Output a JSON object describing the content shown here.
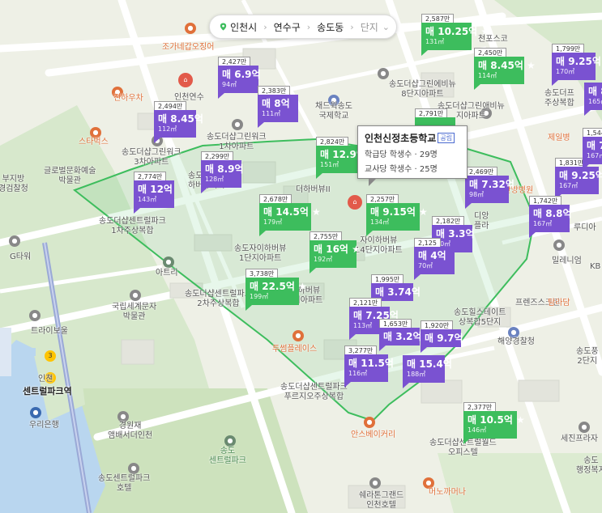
{
  "breadcrumb": {
    "city": "인천시",
    "district": "연수구",
    "dong": "송도동",
    "complex": "단지"
  },
  "school_tooltip": {
    "name": "인천신정초등학교",
    "badge": "공립",
    "hakgudang": "학급당 학생수 · 29명",
    "gyosadang": "교사당 학생수 · 25명"
  },
  "listings": [
    {
      "id": "m1",
      "price_top": "2,587만",
      "label": "매 10.25억 ★",
      "area": "131㎡",
      "color": "green"
    },
    {
      "id": "m2",
      "price_top": "2,450만",
      "label": "매 8.45억 ★",
      "area": "114㎡",
      "color": "green"
    },
    {
      "id": "m3",
      "price_top": "1,799만",
      "label": "매 9.25억",
      "area": "170㎡",
      "color": "purple"
    },
    {
      "id": "m4",
      "price_top": "2,427만",
      "label": "매 6.9억",
      "area": "94㎡",
      "color": "purple"
    },
    {
      "id": "m5",
      "price_top": "2,383만",
      "label": "매 8억",
      "area": "111㎡",
      "color": "purple"
    },
    {
      "id": "m6",
      "price_top": "2,494만",
      "label": "매 8.45억",
      "area": "112㎡",
      "color": "purple"
    },
    {
      "id": "m7",
      "price_top": "2,791만",
      "label": "",
      "area": "",
      "color": "green"
    },
    {
      "id": "m8",
      "price_top": "2,824만",
      "label": "매 12.9억",
      "area": "151㎡",
      "color": "green"
    },
    {
      "id": "m9",
      "price_top": "2,299만",
      "label": "매 8.9억",
      "area": "128㎡",
      "color": "purple"
    },
    {
      "id": "m10",
      "price_top": "2,774만",
      "label": "매 12억",
      "area": "143㎡",
      "color": "purple"
    },
    {
      "id": "m11",
      "price_top": "2,469만",
      "label": "매 7.32억",
      "area": "98㎡",
      "color": "purple"
    },
    {
      "id": "m12",
      "price_top": "1,831만",
      "label": "매 9.25억",
      "area": "167㎡",
      "color": "purple"
    },
    {
      "id": "m13",
      "price_top": "1,742만",
      "label": "매 8.8억",
      "area": "167㎡",
      "color": "purple"
    },
    {
      "id": "m14",
      "price_top": "2,678만",
      "label": "매 14.5억 ★",
      "area": "179㎡",
      "color": "green"
    },
    {
      "id": "m15",
      "price_top": "2,257만",
      "label": "매 9.15억 ★",
      "area": "134㎡",
      "color": "green"
    },
    {
      "id": "m16",
      "price_top": "2,182만",
      "label": "매 3.3억",
      "area": "50㎡",
      "color": "purple"
    },
    {
      "id": "m17",
      "price_top": "2,755만",
      "label": "매 16억 ★",
      "area": "192㎡",
      "color": "green"
    },
    {
      "id": "m18",
      "price_top": "2,125",
      "label": "매 4억",
      "area": "70㎡",
      "color": "purple"
    },
    {
      "id": "m19",
      "price_top": "3,738만",
      "label": "매 22.5억 ★",
      "area": "199㎡",
      "color": "green"
    },
    {
      "id": "m20",
      "price_top": "1,995만",
      "label": "매 3.74억",
      "area": "",
      "color": "purple"
    },
    {
      "id": "m21",
      "price_top": "2,121만",
      "label": "매 7.25억",
      "area": "113㎡",
      "color": "purple"
    },
    {
      "id": "m22",
      "price_top": "1,653만",
      "label": "매 3.2억",
      "area": "",
      "color": "purple"
    },
    {
      "id": "m23",
      "price_top": "1,920만",
      "label": "매 9.7억",
      "area": "",
      "color": "purple"
    },
    {
      "id": "m24",
      "price_top": "3,277만",
      "label": "매 11.5억",
      "area": "116㎡",
      "color": "purple"
    },
    {
      "id": "m25",
      "price_top": "",
      "label": "매 15.4억",
      "area": "188㎡",
      "color": "purple"
    },
    {
      "id": "m26",
      "price_top": "2,377만",
      "label": "매 10.5억 ★",
      "area": "146㎡",
      "color": "green"
    },
    {
      "id": "m27",
      "price_top": "1,544만",
      "label": "매 7.",
      "area": "167㎡",
      "color": "purple"
    },
    {
      "id": "m28",
      "price_top": "",
      "label": "매 8",
      "area": "165㎡",
      "color": "purple"
    }
  ],
  "places": [
    {
      "id": "p1",
      "text": "조가네갑오징어",
      "style": "orange"
    },
    {
      "id": "p2",
      "text": "진하우차",
      "style": "orange"
    },
    {
      "id": "p3",
      "text": "인천연수",
      "style": "normal"
    },
    {
      "id": "p4",
      "text": "스타벅스",
      "style": "orange"
    },
    {
      "id": "p5",
      "text": "송도더샵그린워크\n3차아파트",
      "style": "normal"
    },
    {
      "id": "p6",
      "text": "송도더샵그린워크\n1차아파트",
      "style": "normal"
    },
    {
      "id": "p7",
      "text": "채드윅송도\n국제학교",
      "style": "normal"
    },
    {
      "id": "p8",
      "text": "송도더샵그린에비뉴\n8단지아파트",
      "style": "normal"
    },
    {
      "id": "p9",
      "text": "천포스코",
      "style": "normal"
    },
    {
      "id": "p10",
      "text": "송도더샵그린애비뉴\n지아파트",
      "style": "normal"
    },
    {
      "id": "p11",
      "text": "송도더프\n주상복합",
      "style": "normal"
    },
    {
      "id": "p12",
      "text": "제일병",
      "style": "orange"
    },
    {
      "id": "p13",
      "text": "글로벌문화예술\n박물관",
      "style": "normal"
    },
    {
      "id": "p14",
      "text": "부지방\n경검찰청",
      "style": "normal"
    },
    {
      "id": "p15",
      "text": "송도푸르지오\n하버뷰아파트",
      "style": "normal"
    },
    {
      "id": "p16",
      "text": "송도더샵센트럴파크\n1차주상복합",
      "style": "normal"
    },
    {
      "id": "p17",
      "text": "G타워",
      "style": "normal"
    },
    {
      "id": "p18",
      "text": "송도자이하버뷰\n1단지아파트",
      "style": "normal"
    },
    {
      "id": "p19",
      "text": "더하버뷰II",
      "style": "normal"
    },
    {
      "id": "p20",
      "text": "자이하버뷰\n14단지아파트",
      "style": "normal"
    },
    {
      "id": "p21",
      "text": "디앙\n플라",
      "style": "normal"
    },
    {
      "id": "p22",
      "text": "자양한방병원",
      "style": "orange"
    },
    {
      "id": "p23",
      "text": "루디아",
      "style": "normal"
    },
    {
      "id": "p24",
      "text": "밀레니엄",
      "style": "normal"
    },
    {
      "id": "p25",
      "text": "아트리",
      "style": "normal"
    },
    {
      "id": "p26",
      "text": "송도더샵센트럴파크\n2차주상복합",
      "style": "normal"
    },
    {
      "id": "p27",
      "text": "자이하버뷰\n3단지아파트",
      "style": "normal"
    },
    {
      "id": "p28",
      "text": "국립세계문자\n박물관",
      "style": "normal"
    },
    {
      "id": "p29",
      "text": "트라이보울",
      "style": "normal"
    },
    {
      "id": "p30",
      "text": "프렌즈스크린",
      "style": "normal"
    },
    {
      "id": "p31",
      "text": "탐라담",
      "style": "orange"
    },
    {
      "id": "p32",
      "text": "송도힐스테이트\n상복합5단지",
      "style": "normal"
    },
    {
      "id": "p33",
      "text": "투썸플레이스",
      "style": "orange"
    },
    {
      "id": "p34",
      "text": "해양경찰청",
      "style": "normal"
    },
    {
      "id": "p35",
      "text": "송도풍\n2단지",
      "style": "normal"
    },
    {
      "id": "p36",
      "text": "인천",
      "style": "normal"
    },
    {
      "id": "p37",
      "text": "센트럴파크역",
      "style": "big"
    },
    {
      "id": "p38",
      "text": "송도더샵센트럴파크\n푸르지오주상복합",
      "style": "normal"
    },
    {
      "id": "p39",
      "text": "우리은행",
      "style": "normal"
    },
    {
      "id": "p40",
      "text": "안스베이커리",
      "style": "orange"
    },
    {
      "id": "p41",
      "text": "경원재\n앰배서더인천",
      "style": "normal"
    },
    {
      "id": "p42",
      "text": "송도\n센트럴파크",
      "style": "green"
    },
    {
      "id": "p43",
      "text": "송도더샵센트럴월드\n오피스텔",
      "style": "normal"
    },
    {
      "id": "p44",
      "text": "세진프라자",
      "style": "normal"
    },
    {
      "id": "p45",
      "text": "송도\n행정복지",
      "style": "normal"
    },
    {
      "id": "p46",
      "text": "송도센트럴파크\n호텔",
      "style": "normal"
    },
    {
      "id": "p47",
      "text": "쉐라톤그랜드\n인천호텔",
      "style": "normal"
    },
    {
      "id": "p48",
      "text": "머노까머나",
      "style": "orange"
    },
    {
      "id": "p49",
      "text": "KB",
      "style": "normal"
    }
  ],
  "colors": {
    "purple_marker": "#7a52d1",
    "green_marker": "#3dbd5d",
    "boundary": "#3dbd5d",
    "park": "#cde2bd",
    "road": "#ffffff"
  }
}
